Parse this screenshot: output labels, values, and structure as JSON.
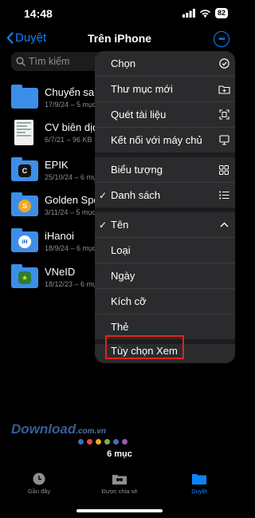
{
  "status_bar": {
    "time": "14:48",
    "battery": "82"
  },
  "nav": {
    "back_label": "Duyệt",
    "title": "Trên iPhone"
  },
  "search": {
    "placeholder": "Tìm kiếm"
  },
  "files": [
    {
      "name": "Chuyển sang",
      "meta": "17/9/24 – 5 mục",
      "icon": "folder-icon"
    },
    {
      "name": "CV biên dịch",
      "meta": "6/7/21 – 96 KB",
      "icon": "document-icon"
    },
    {
      "name": "EPIK",
      "meta": "25/10/24 – 6 mục",
      "icon": "epik-folder-icon"
    },
    {
      "name": "Golden Spo",
      "meta": "3/11/24 – 5 mục",
      "icon": "golden-spoon-folder-icon"
    },
    {
      "name": "iHanoi",
      "meta": "18/9/24 – 6 mục",
      "icon": "ihanoi-folder-icon"
    },
    {
      "name": "VNeID",
      "meta": "18/12/23 – 6 mục",
      "icon": "vneid-folder-icon"
    }
  ],
  "menu": {
    "items": [
      {
        "label": "Chọn",
        "icon": "checkmark-circle-icon",
        "checked": false
      },
      {
        "label": "Thư mục mới",
        "icon": "new-folder-icon",
        "checked": false
      },
      {
        "label": "Quét tài liệu",
        "icon": "scan-document-icon",
        "checked": false
      },
      {
        "label": "Kết nối với máy chủ",
        "icon": "server-monitor-icon",
        "checked": false
      },
      {
        "label": "Biểu tượng",
        "icon": "grid-icon",
        "checked": false
      },
      {
        "label": "Danh sách",
        "icon": "list-icon",
        "checked": true
      },
      {
        "label": "Tên",
        "icon": "chevron-up-icon",
        "checked": true
      },
      {
        "label": "Loại",
        "checked": false
      },
      {
        "label": "Ngày",
        "checked": false
      },
      {
        "label": "Kích cỡ",
        "checked": false
      },
      {
        "label": "Thẻ",
        "checked": false
      },
      {
        "label": "Tùy chọn Xem",
        "checked": false
      }
    ]
  },
  "watermark": {
    "main": "Download",
    "suffix": ".com.vn"
  },
  "footer": {
    "count": "6 mục"
  },
  "tabs": [
    {
      "label": "Gần đây",
      "icon": "clock-icon",
      "active": false
    },
    {
      "label": "Được chia sẻ",
      "icon": "shared-folder-icon",
      "active": false
    },
    {
      "label": "Duyệt",
      "icon": "folder-icon",
      "active": true
    }
  ],
  "colors": {
    "accent": "#0a84ff",
    "highlight_border": "#e0241d",
    "menu_bg": "#2b2b2d"
  }
}
